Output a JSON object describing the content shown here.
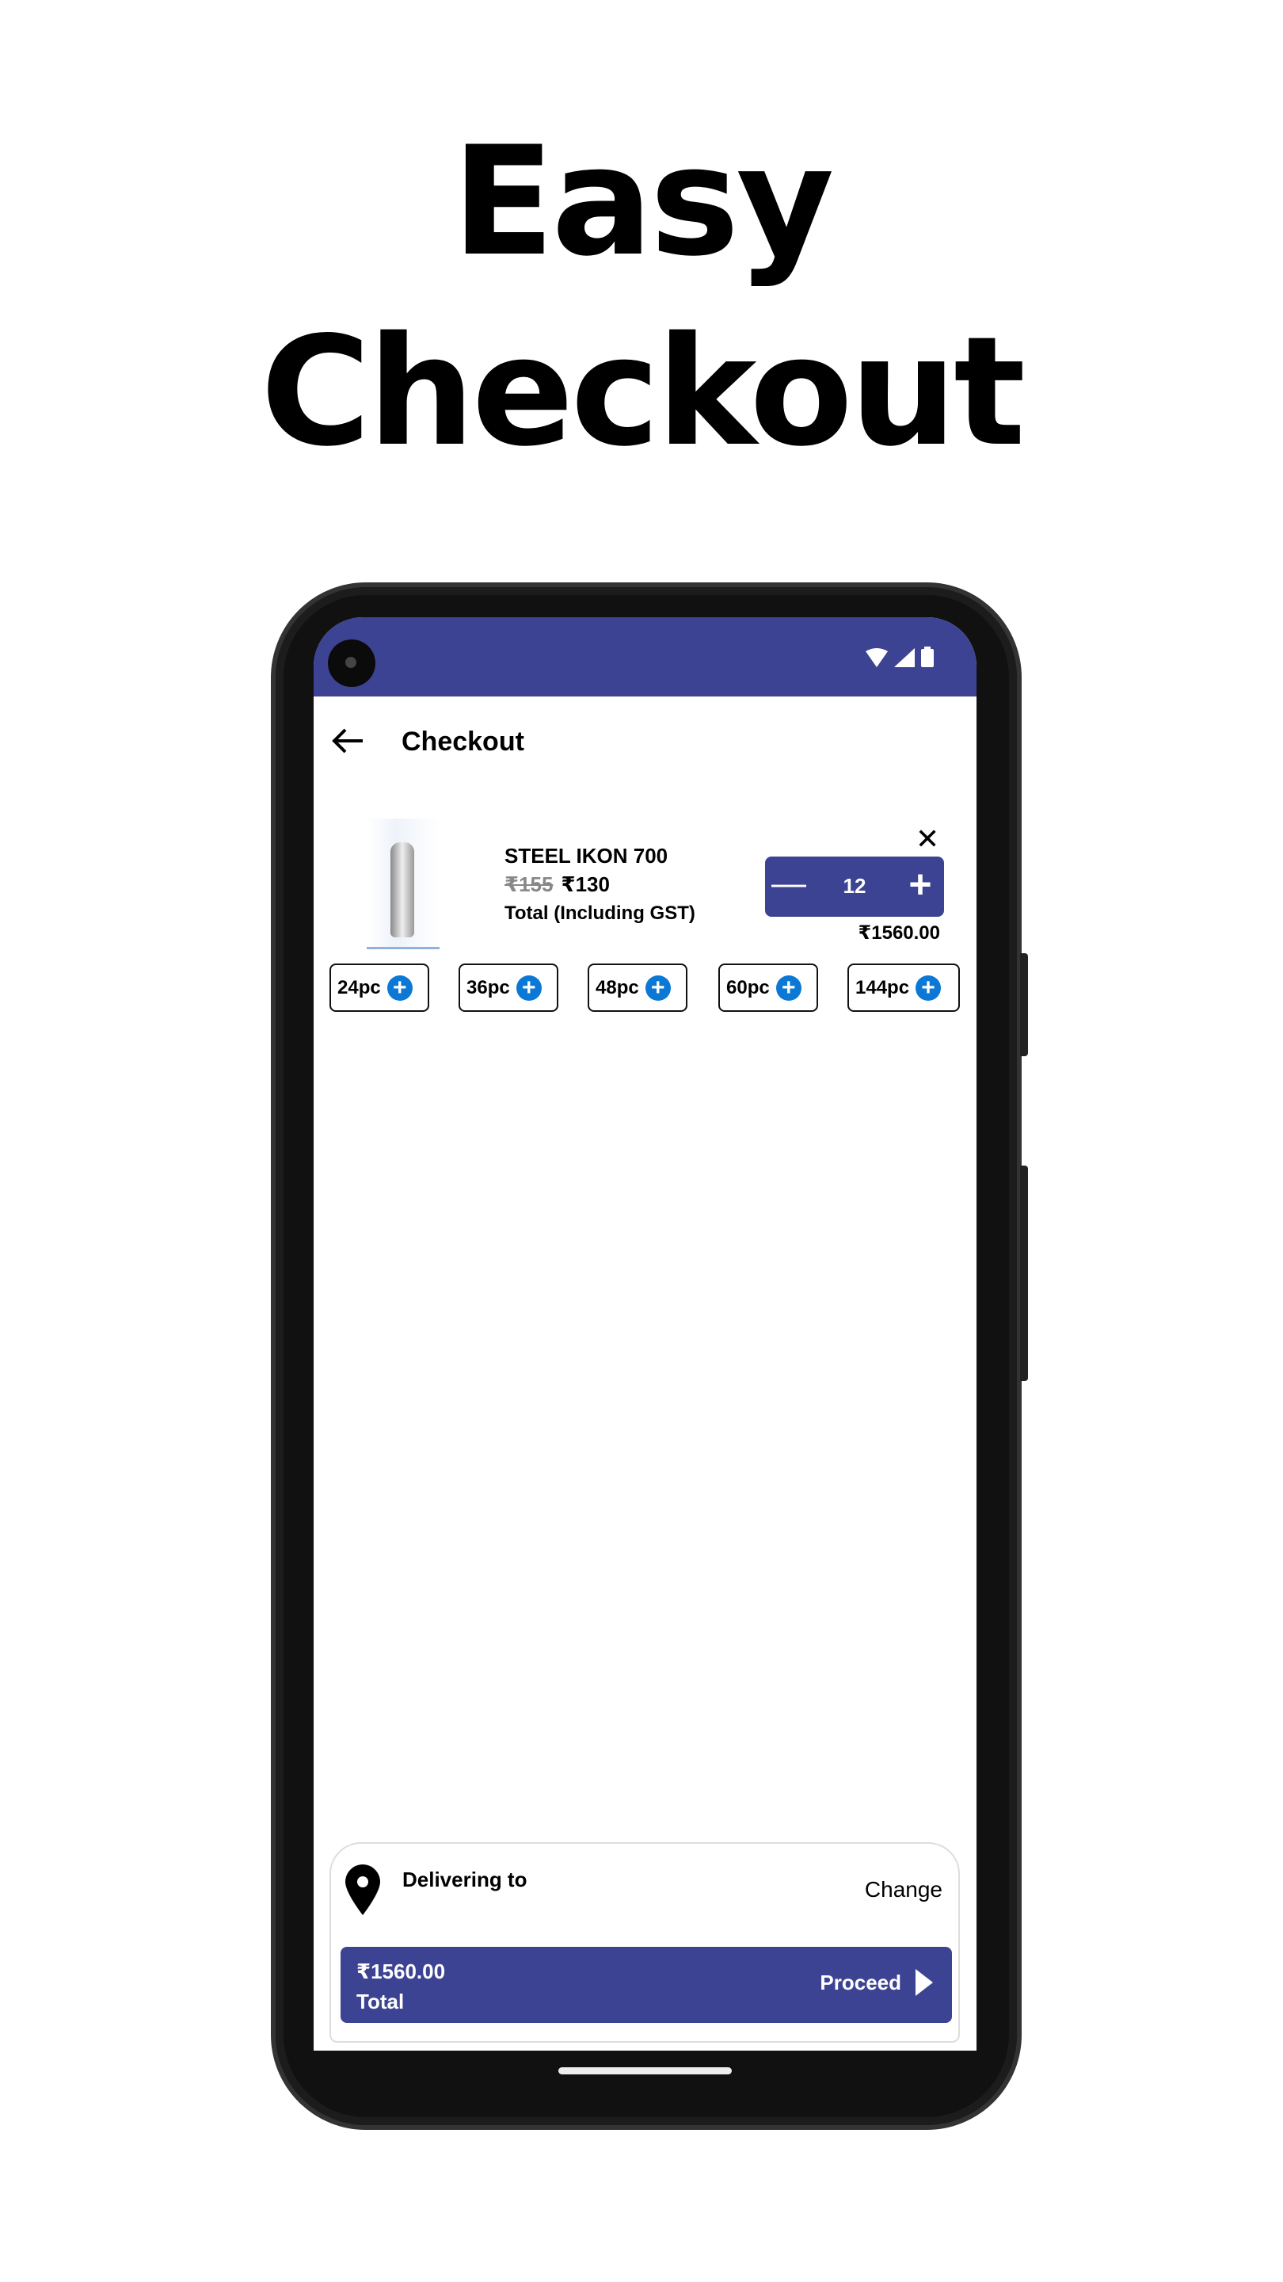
{
  "headline": {
    "line1": "Easy",
    "line2": "Checkout"
  },
  "status_bar": {
    "icons": [
      "wifi-icon",
      "signal-icon",
      "battery-icon"
    ]
  },
  "header": {
    "title": "Checkout",
    "back_icon": "arrow-left-icon"
  },
  "cart_item": {
    "name": "STEEL IKON 700",
    "original_price": "₹155",
    "price": "₹130",
    "total_label": "Total (Including GST)",
    "quantity": "12",
    "line_total": "₹1560.00",
    "remove_icon": "close-icon"
  },
  "quick_add": [
    {
      "label": "24pc"
    },
    {
      "label": "36pc"
    },
    {
      "label": "48pc"
    },
    {
      "label": "60pc"
    },
    {
      "label": "144pc"
    }
  ],
  "delivery": {
    "label": "Delivering to",
    "change": "Change"
  },
  "footer": {
    "total": "₹1560.00",
    "total_label": "Total",
    "proceed": "Proceed"
  },
  "colors": {
    "primary": "#3d4393",
    "add_button": "#0a78d4"
  }
}
